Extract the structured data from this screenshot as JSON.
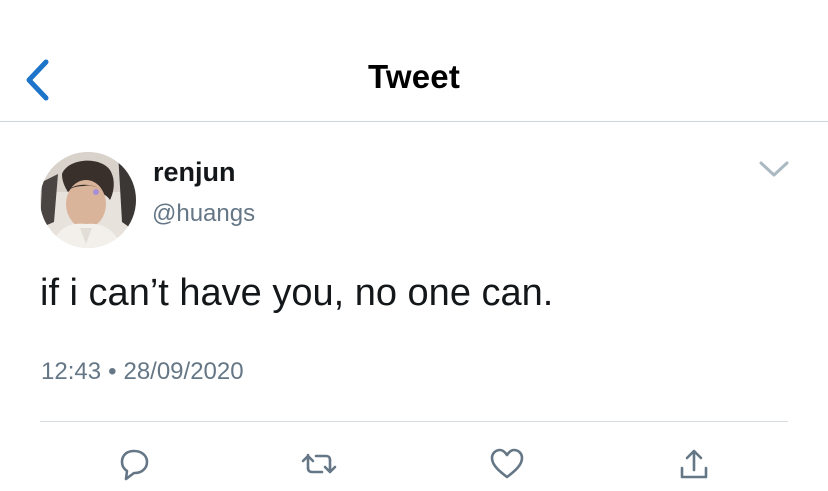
{
  "header": {
    "title": "Tweet",
    "back_icon": "chevron-left-icon",
    "accent_color": "#1d74c9"
  },
  "tweet": {
    "author": {
      "display_name": "renjun",
      "handle": "@huangs",
      "avatar": "profile-photo"
    },
    "text": "if i can’t have you, no one can.",
    "time": "12:43",
    "separator": "•",
    "date": "28/09/2020"
  },
  "actions": {
    "reply_icon": "reply-icon",
    "retweet_icon": "retweet-icon",
    "like_icon": "heart-icon",
    "share_icon": "share-icon",
    "icon_color": "#657786"
  }
}
